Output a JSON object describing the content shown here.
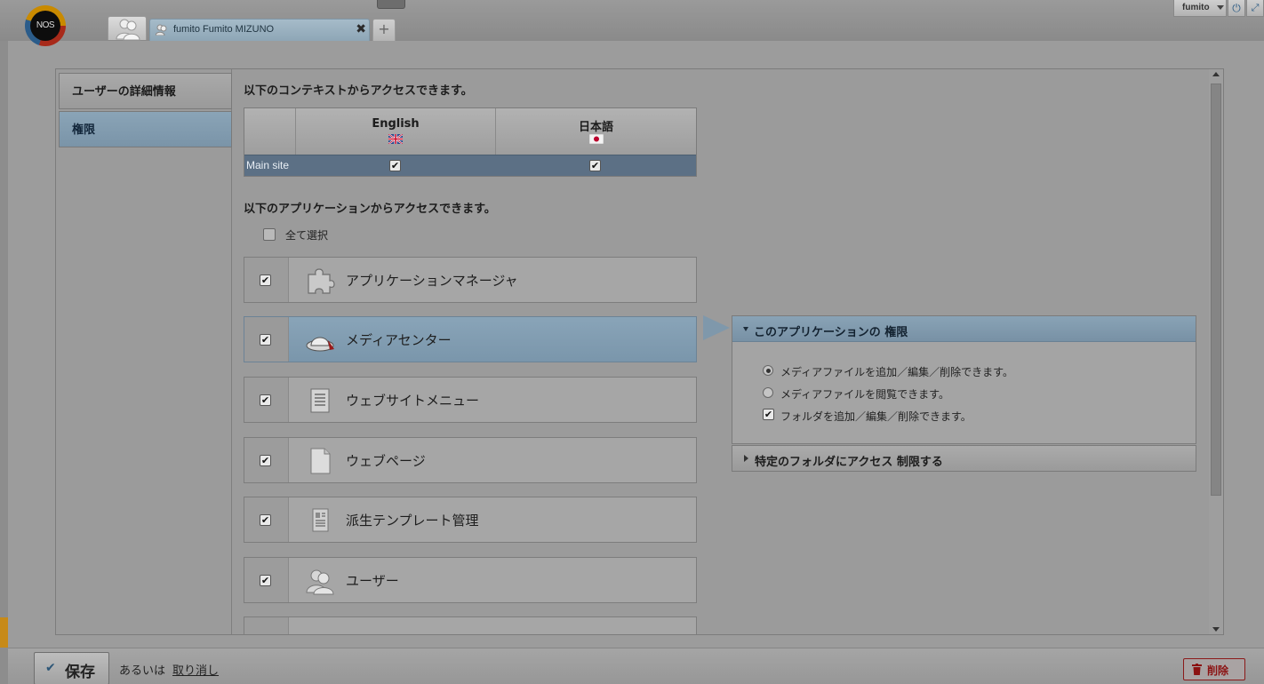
{
  "window": {
    "logo_text": "NOS",
    "tab_label": "fumito Fumito MIZUNO",
    "tab_close": "✖",
    "tab_add": "+",
    "user_name": "fumito"
  },
  "sidebar": {
    "items": [
      {
        "label": "ユーザーの詳細情報",
        "active": false
      },
      {
        "label": "権限",
        "active": true
      }
    ]
  },
  "contexts": {
    "heading": "以下のコンテキストからアクセスできます。",
    "columns": [
      {
        "label": "English",
        "flag": "uk-flag-icon"
      },
      {
        "label": "日本語",
        "flag": "jp-flag-icon"
      }
    ],
    "rows": [
      {
        "label": "Main site",
        "checked": [
          true,
          true
        ]
      }
    ]
  },
  "applications": {
    "heading": "以下のアプリケーションからアクセスできます。",
    "select_all": "全て選択",
    "items": [
      {
        "label": "アプリケーションマネージャ",
        "checked": true,
        "icon": "puzzle-icon",
        "active": false
      },
      {
        "label": "メディアセンター",
        "checked": true,
        "icon": "media-hat-icon",
        "active": true
      },
      {
        "label": "ウェブサイトメニュー",
        "checked": true,
        "icon": "menu-list-icon",
        "active": false
      },
      {
        "label": "ウェブページ",
        "checked": true,
        "icon": "page-icon",
        "active": false
      },
      {
        "label": "派生テンプレート管理",
        "checked": true,
        "icon": "template-icon",
        "active": false
      },
      {
        "label": "ユーザー",
        "checked": true,
        "icon": "users-icon",
        "active": false
      }
    ]
  },
  "permissions": {
    "heading": "このアプリケーションの 権限",
    "options": [
      {
        "type": "radio",
        "label": "メディアファイルを追加／編集／削除できます。",
        "selected": true
      },
      {
        "type": "radio",
        "label": "メディアファイルを閲覧できます。",
        "selected": false
      },
      {
        "type": "checkbox",
        "label": "フォルダを追加／編集／削除できます。",
        "selected": true
      }
    ],
    "folder_restrict": "特定のフォルダにアクセス 制限する"
  },
  "footer": {
    "save_label": "保存",
    "or_text": "あるいは",
    "cancel_label": "取り消し",
    "delete_label": "削除"
  },
  "colors": {
    "accent_blue": "#7f98ab",
    "delete_red": "#8b1212"
  }
}
